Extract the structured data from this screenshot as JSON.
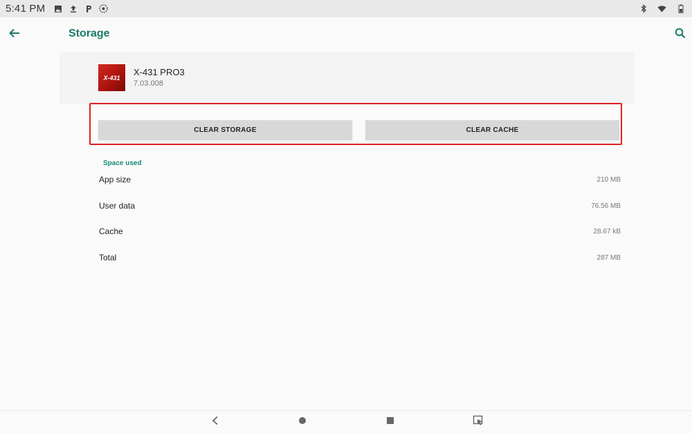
{
  "status_bar": {
    "time": "5:41 PM",
    "left_icons": [
      "image-icon",
      "upload-icon",
      "p-icon",
      "gear-circle-icon"
    ],
    "right_icons": [
      "bluetooth-icon",
      "wifi-icon",
      "battery-icon"
    ]
  },
  "app_bar": {
    "title": "Storage",
    "back_icon": "arrow-left-icon",
    "search_icon": "search-icon",
    "accent_color": "#1a7a69"
  },
  "app": {
    "name": "X-431 PRO3",
    "version": "7.03.008",
    "icon_text": "X-431"
  },
  "buttons": {
    "clear_storage": "CLEAR STORAGE",
    "clear_cache": "CLEAR CACHE"
  },
  "highlight_color": "#e02020",
  "space_used": {
    "title": "Space used",
    "rows": [
      {
        "label": "App size",
        "value": "210 MB"
      },
      {
        "label": "User data",
        "value": "76.56 MB"
      },
      {
        "label": "Cache",
        "value": "28.67 kB"
      },
      {
        "label": "Total",
        "value": "287 MB"
      }
    ]
  },
  "nav_bar": {
    "icons": [
      "back-triangle-icon",
      "home-circle-icon",
      "recents-square-icon",
      "screenshot-icon"
    ]
  }
}
